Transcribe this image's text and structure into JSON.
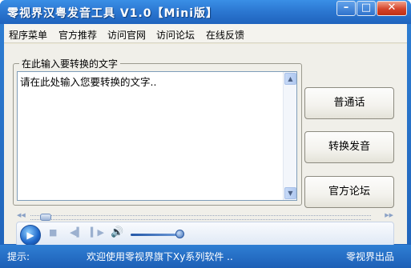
{
  "window": {
    "title": "零视界汉粤发音工具 V1.0【Mini版】",
    "buttons": {
      "minimize": "–",
      "maximize": "□",
      "close": "✕"
    }
  },
  "menu": {
    "items": [
      {
        "label": "程序菜单"
      },
      {
        "label": "官方推荐"
      },
      {
        "label": "访问官网"
      },
      {
        "label": "访问论坛"
      },
      {
        "label": "在线反馈"
      }
    ]
  },
  "input_group": {
    "title": "在此输入要转换的文字",
    "text": "请在此处输入您要转换的文字.."
  },
  "actions": {
    "mandarin": "普通话",
    "convert": "转换发音",
    "forum": "官方论坛"
  },
  "player": {
    "icons": {
      "play": "play-icon",
      "stop": "stop-icon",
      "prev": "previous-icon",
      "next": "next-icon",
      "volume": "volume-icon"
    }
  },
  "status": {
    "label": "提示:",
    "message": "欢迎使用零视界旗下Xy系列软件 ..",
    "brand": "零视界出品"
  },
  "colors": {
    "titlebar": "#2c78d2",
    "statusbar": "#1f63bd",
    "client_bg": "#f0efe9"
  }
}
